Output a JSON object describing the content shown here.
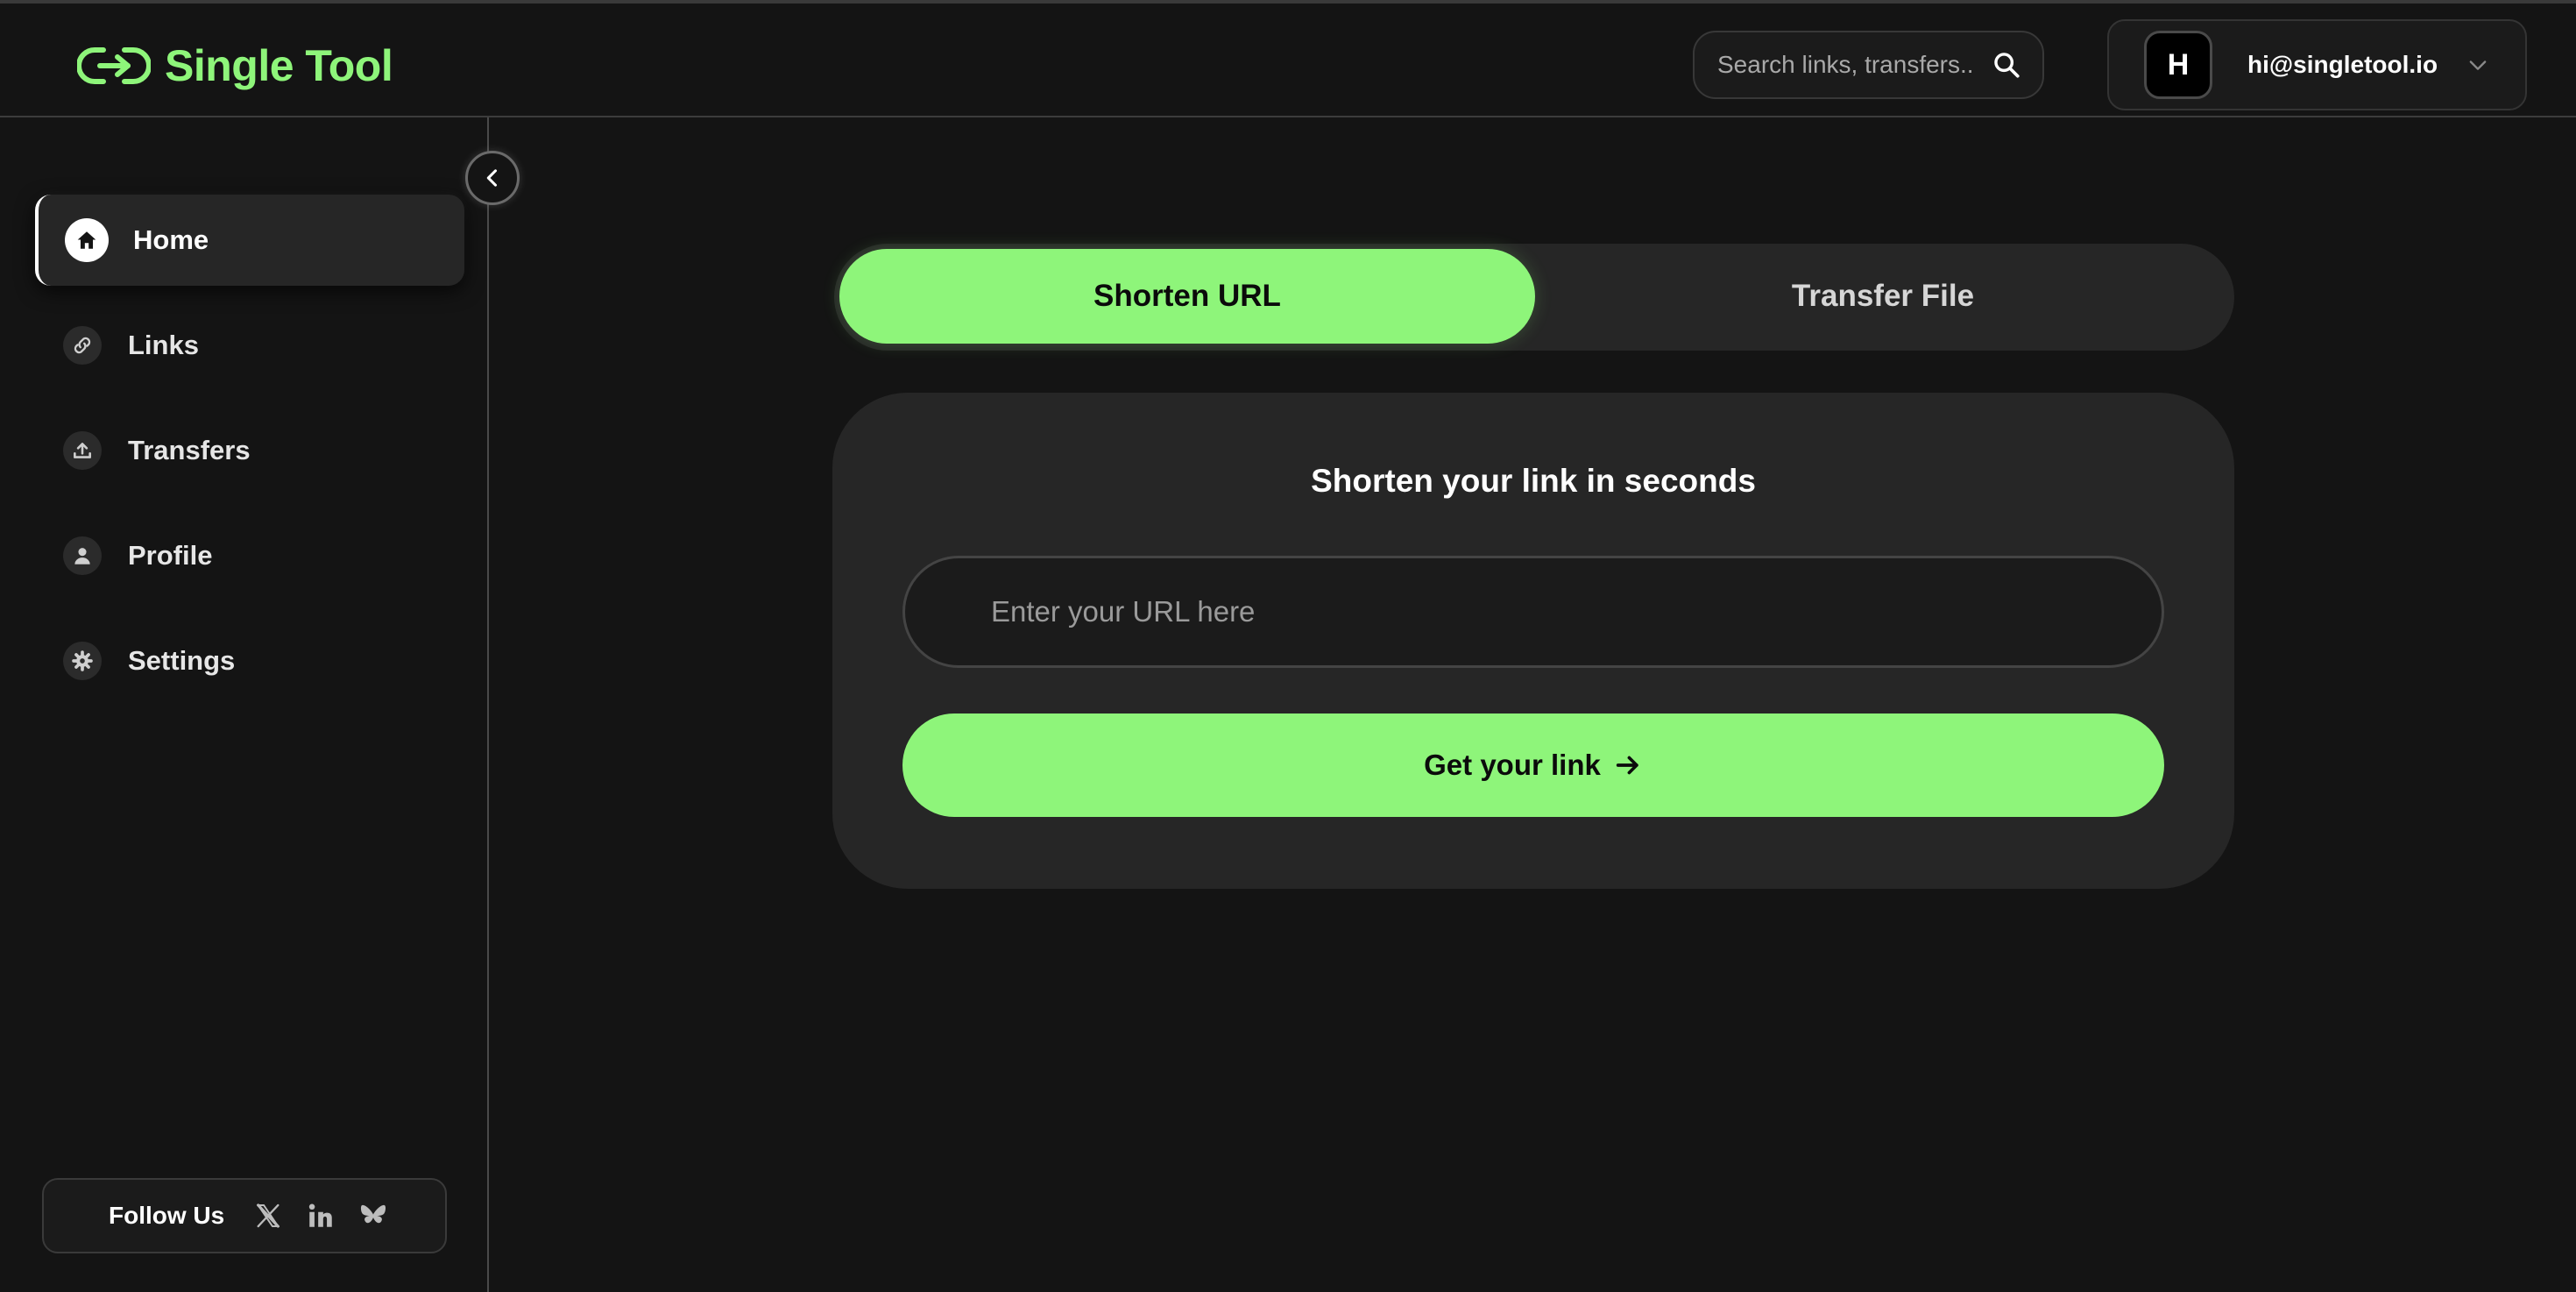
{
  "brand": {
    "name": "Single Tool",
    "accent": "#8ef57a",
    "logo_icon": "link-icon"
  },
  "search": {
    "placeholder": "Search links, transfers..",
    "icon": "search-icon"
  },
  "account": {
    "avatar_initial": "H",
    "email": "hi@singletool.io",
    "icon": "chevron-down-icon"
  },
  "sidebar": {
    "collapse_icon": "chevron-left-icon",
    "items": [
      {
        "label": "Home",
        "icon": "home-icon",
        "active": true
      },
      {
        "label": "Links",
        "icon": "link-icon",
        "active": false
      },
      {
        "label": "Transfers",
        "icon": "upload-icon",
        "active": false
      },
      {
        "label": "Profile",
        "icon": "user-icon",
        "active": false
      },
      {
        "label": "Settings",
        "icon": "gear-icon",
        "active": false
      }
    ],
    "follow": {
      "label": "Follow Us",
      "socials": [
        "x-icon",
        "linkedin-icon",
        "bluesky-icon"
      ]
    }
  },
  "main": {
    "tabs": [
      {
        "label": "Shorten URL",
        "active": true
      },
      {
        "label": "Transfer File",
        "active": false
      }
    ],
    "card": {
      "title": "Shorten your link in seconds",
      "url_placeholder": "Enter your URL here",
      "url_value": "",
      "cta_label": "Get your link",
      "cta_icon": "arrow-right-icon"
    }
  }
}
